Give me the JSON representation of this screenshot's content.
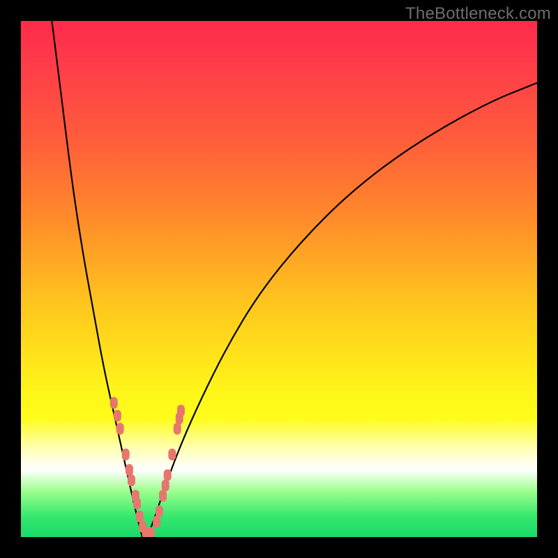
{
  "watermark": "TheBottleneck.com",
  "colors": {
    "dot": "#e7766f",
    "curve": "#000000",
    "gradient_top": "#ff2a4a",
    "gradient_bottom": "#1bd96a"
  },
  "chart_data": {
    "type": "line",
    "title": "",
    "xlabel": "",
    "ylabel": "",
    "xlim": [
      0,
      100
    ],
    "ylim": [
      0,
      100
    ],
    "grid": false,
    "legend": false,
    "note": "Unlabeled bottleneck V-curve; y≈mismatch (0 good, 100 bad), x≈component power. Values estimated from pixels.",
    "series": [
      {
        "name": "left-curve",
        "x": [
          6,
          8,
          10,
          12,
          14,
          16,
          18,
          20,
          22,
          23.5
        ],
        "y": [
          100,
          84,
          68,
          55,
          44,
          33,
          24,
          15,
          6,
          0
        ]
      },
      {
        "name": "right-curve",
        "x": [
          24.5,
          26,
          28,
          31,
          35,
          40,
          46,
          54,
          64,
          76,
          90,
          100
        ],
        "y": [
          0,
          4,
          10,
          18,
          27,
          37,
          47,
          57,
          67,
          76,
          84,
          88
        ]
      }
    ],
    "points": [
      {
        "name": "left-cluster",
        "xy": [
          [
            18,
            26
          ],
          [
            18.7,
            23.5
          ],
          [
            19.2,
            21
          ],
          [
            20.3,
            16
          ],
          [
            21,
            13
          ],
          [
            21.4,
            11
          ],
          [
            22.2,
            8
          ],
          [
            22.5,
            6.5
          ],
          [
            23,
            4
          ],
          [
            23.6,
            2
          ]
        ]
      },
      {
        "name": "bottom-bridge",
        "xy": [
          [
            24.2,
            0.8
          ],
          [
            25.2,
            0.8
          ]
        ]
      },
      {
        "name": "right-cluster",
        "xy": [
          [
            26.3,
            3
          ],
          [
            26.8,
            5
          ],
          [
            27.5,
            8
          ],
          [
            28,
            10
          ],
          [
            28.4,
            12
          ],
          [
            29.3,
            16
          ],
          [
            30.3,
            21
          ],
          [
            30.7,
            23
          ],
          [
            31,
            24.5
          ]
        ]
      }
    ]
  }
}
